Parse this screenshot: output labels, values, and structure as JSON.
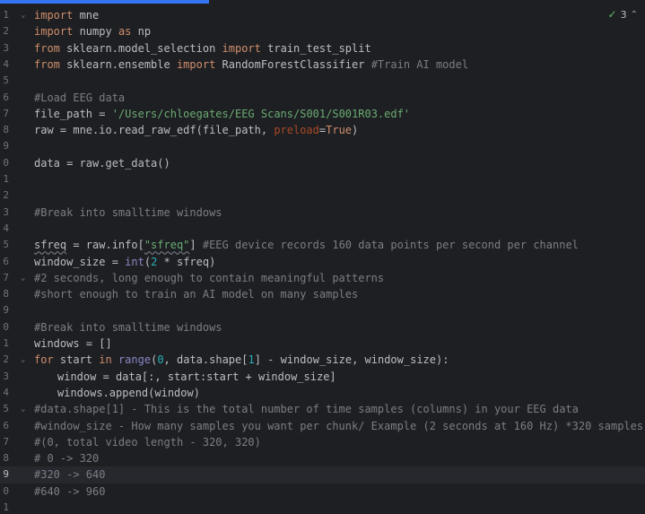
{
  "editor": {
    "inspection": {
      "count": "3",
      "check_icon": "check-icon",
      "chevron_icon": "chevron-up-icon"
    },
    "line_numbers": [
      "1",
      "2",
      "3",
      "4",
      "5",
      "6",
      "7",
      "8",
      "9",
      "0",
      "1",
      "2",
      "3",
      "4",
      "5",
      "6",
      "7",
      "8",
      "9",
      "0",
      "1",
      "2",
      "3",
      "4",
      "5",
      "6",
      "7",
      "8",
      "9",
      "0",
      "1"
    ],
    "lines": {
      "l1_kw": "import",
      "l1_rest": " mne",
      "l2_kw": "import",
      "l2_a": " numpy ",
      "l2_kw2": "as",
      "l2_b": " np",
      "l3_kw": "from",
      "l3_a": " sklearn.model_selection ",
      "l3_kw2": "import",
      "l3_b": " train_test_split",
      "l4_kw": "from",
      "l4_a": " sklearn.ensemble ",
      "l4_kw2": "import",
      "l4_b": " RandomForestClassifier ",
      "l4_cm": "#Train AI model",
      "l6_cm": "#Load EEG data",
      "l7_a": "file_path = ",
      "l7_str": "'/Users/chloegates/EEG Scans/S001/S001R03.edf'",
      "l8_a": "raw = mne.io.read_raw_edf(file_path, ",
      "l8_param": "preload",
      "l8_b": "=",
      "l8_kw": "True",
      "l8_c": ")",
      "l10_a": "data = raw.get_data()",
      "l13_cm": "#Break into smalltime windows",
      "l15_a": "sfreq",
      "l15_b": " = raw.info[",
      "l15_str": "\"sfreq\"",
      "l15_c": "] ",
      "l15_cm": "#EEG device records 160 data points per second per channel",
      "l16_a": "window_size = ",
      "l16_bi": "int",
      "l16_b": "(",
      "l16_num": "2",
      "l16_c": " * sfreq)",
      "l17_cm": "#2 seconds, long enough to contain meaningful patterns",
      "l18_cm": "#short enough to train an AI model on many samples",
      "l20_cm": "#Break into smalltime windows",
      "l21_a": "windows = []",
      "l22_kw": "for",
      "l22_a": " start ",
      "l22_kw2": "in",
      "l22_b": " ",
      "l22_bi": "range",
      "l22_c": "(",
      "l22_num": "0",
      "l22_d": ", data.shape[",
      "l22_num2": "1",
      "l22_e": "] - window_size, window_size):",
      "l23_a": "window = data[:, start:start + window_size]",
      "l24_a": "windows.append(window)",
      "l25_cm": "#data.shape[1] - This is the total number of time samples (columns) in your EEG data",
      "l26_cm": "#window_size - How many samples you want per chunk/ Example (2 seconds at 160 Hz) *320 samples",
      "l27_cm": "#(0, total video length - 320, 320)",
      "l28_cm": "# 0 -> 320",
      "l29_cm": "#320 -> 640",
      "l30_cm": "#640 -> 960"
    }
  }
}
